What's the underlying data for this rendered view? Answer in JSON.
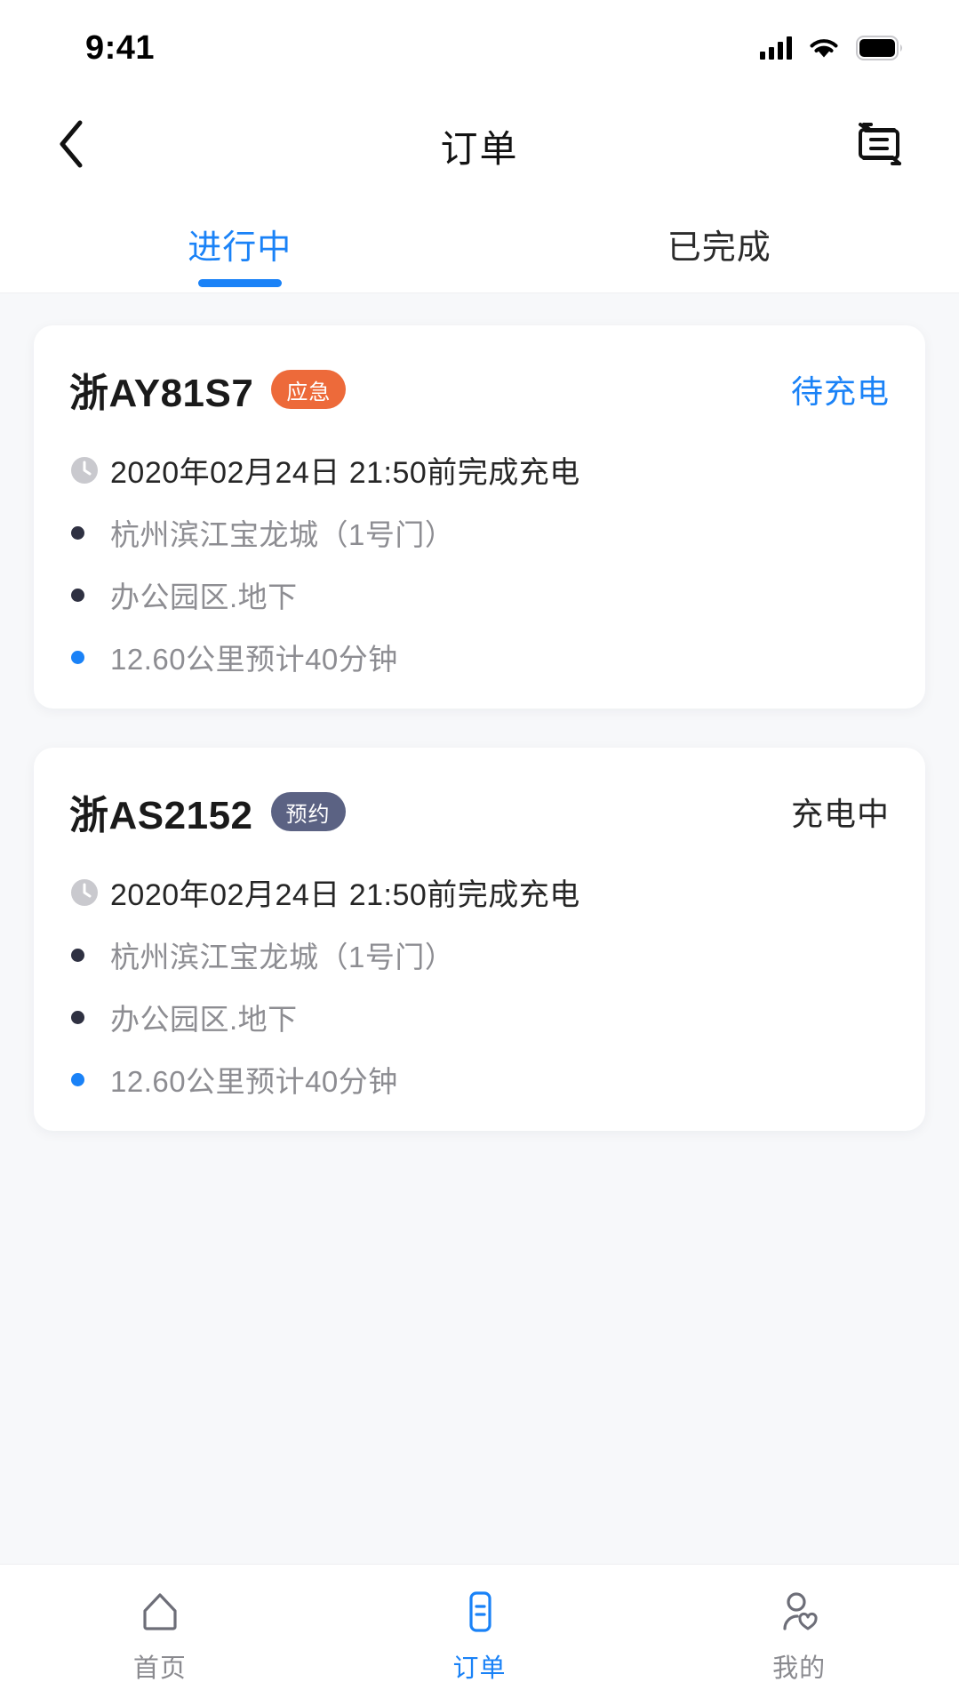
{
  "status_bar": {
    "time": "9:41",
    "icons": [
      "signal-icon",
      "wifi-icon",
      "battery-icon"
    ]
  },
  "nav": {
    "back_icon": "chevron-left-icon",
    "title": "订单",
    "action_icon": "order-history-icon"
  },
  "tabs": [
    {
      "label": "进行中",
      "active": true
    },
    {
      "label": "已完成",
      "active": false
    }
  ],
  "colors": {
    "accent": "#1a82f7",
    "badge_emergency": "#ED6A3A",
    "badge_reservation": "#5B6283",
    "page_background": "#f7f8fa",
    "card_background": "#ffffff",
    "muted_text": "#8d8d92",
    "dark_text": "#1a1a1a",
    "bullet_dark": "#2f3142"
  },
  "orders": [
    {
      "plate": "浙AY81S7",
      "badge": {
        "label": "应急",
        "color": "#ED6A3A"
      },
      "status": {
        "label": "待充电",
        "color": "#1a82f7"
      },
      "time_icon": "clock-icon",
      "time": "2020年02月24日 21:50前完成充电",
      "details": [
        {
          "bullet": "#2f3142",
          "text": "杭州滨江宝龙城（1号门）"
        },
        {
          "bullet": "#2f3142",
          "text": "办公园区.地下"
        },
        {
          "bullet": "#1a82f7",
          "text": "12.60公里预计40分钟"
        }
      ]
    },
    {
      "plate": "浙AS2152",
      "badge": {
        "label": "预约",
        "color": "#5B6283"
      },
      "status": {
        "label": "充电中",
        "color": "#262626"
      },
      "time_icon": "clock-icon",
      "time": "2020年02月24日 21:50前完成充电",
      "details": [
        {
          "bullet": "#2f3142",
          "text": "杭州滨江宝龙城（1号门）"
        },
        {
          "bullet": "#2f3142",
          "text": "办公园区.地下"
        },
        {
          "bullet": "#1a82f7",
          "text": "12.60公里预计40分钟"
        }
      ]
    }
  ],
  "tab_bar": [
    {
      "label": "首页",
      "icon": "home-icon",
      "active": false
    },
    {
      "label": "订单",
      "icon": "order-document-icon",
      "active": true
    },
    {
      "label": "我的",
      "icon": "user-heart-icon",
      "active": false
    }
  ]
}
